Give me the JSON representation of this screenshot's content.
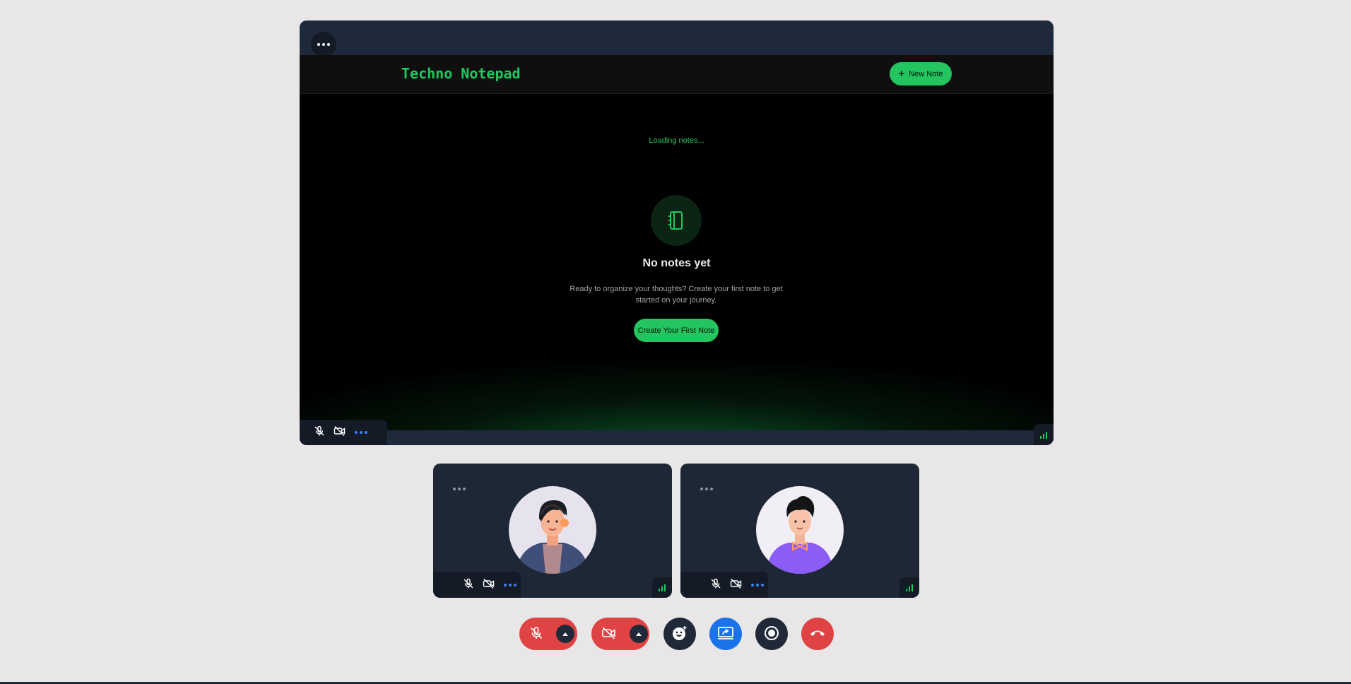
{
  "app": {
    "title": "Techno Notepad",
    "new_note_label": "New Note",
    "loading_text": "Loading notes...",
    "empty_title": "No notes yet",
    "empty_description": "Ready to organize your thoughts? Create your first note to get started on your journey.",
    "create_first_label": "Create Your First Note"
  },
  "colors": {
    "accent": "#22c55e",
    "danger": "#e04343",
    "share": "#1a73e8",
    "tile_bg": "#1e2736",
    "stage_bg": "#1e293b"
  },
  "stage_controls": {
    "icons": [
      "more-icon",
      "mic-off-icon",
      "camera-off-icon",
      "options-icon",
      "signal-icon"
    ]
  },
  "participants": [
    {
      "avatar": "headset-person-avatar",
      "mic": "muted",
      "camera": "off"
    },
    {
      "avatar": "bowtie-person-avatar",
      "mic": "muted",
      "camera": "off"
    }
  ],
  "toolbar": {
    "buttons": [
      "mic-toggle",
      "camera-toggle",
      "reactions",
      "share-screen",
      "record",
      "leave-call"
    ]
  }
}
